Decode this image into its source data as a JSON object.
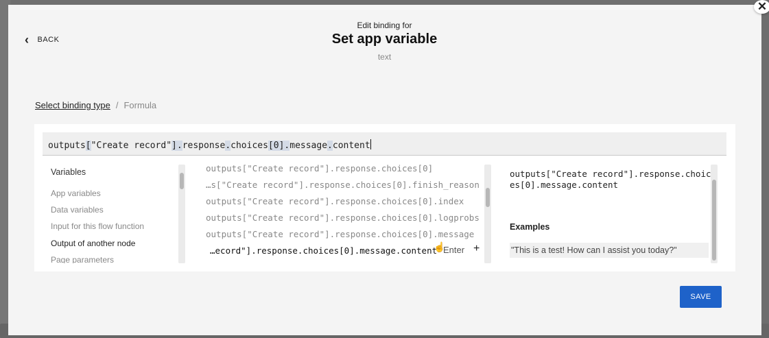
{
  "header": {
    "eyebrow": "Edit binding for",
    "title": "Set app variable",
    "subtitle": "text",
    "back_label": "BACK",
    "close_icon": "close-icon"
  },
  "breadcrumb": {
    "link": "Select binding type",
    "separator": "/",
    "current": "Formula"
  },
  "formula": {
    "parts": [
      "outputs",
      "[",
      "\"Create record\"",
      "]",
      ".",
      "response",
      ".",
      "choices",
      "[",
      "0",
      "]",
      ".",
      "message",
      ".",
      "content"
    ]
  },
  "categories": {
    "heading": "Variables",
    "items": [
      {
        "label": "App variables",
        "active": false
      },
      {
        "label": "Data variables",
        "active": false
      },
      {
        "label": "Input for this flow function",
        "active": false
      },
      {
        "label": "Output of another node",
        "active": true
      },
      {
        "label": "Page parameters",
        "active": false
      }
    ]
  },
  "paths": {
    "rows": [
      "outputs[\"Create record\"].response.choices[0]",
      "…s[\"Create record\"].response.choices[0].finish_reason",
      "outputs[\"Create record\"].response.choices[0].index",
      "outputs[\"Create record\"].response.choices[0].logprobs",
      "outputs[\"Create record\"].response.choices[0].message",
      "…ecord\"].response.choices[0].message.content"
    ],
    "enter_hint": "Enter",
    "add_icon": "+"
  },
  "detail": {
    "path": "outputs[\"Create record\"].response.choices[0].message.content",
    "examples_heading": "Examples",
    "example_value": "\"This is a test! How can I assist you today?\""
  },
  "footer": {
    "save_label": "SAVE"
  },
  "colors": {
    "accent": "#1e62c9",
    "overlay": "#6e6e6e",
    "modal_bg": "#f4f4f4"
  }
}
